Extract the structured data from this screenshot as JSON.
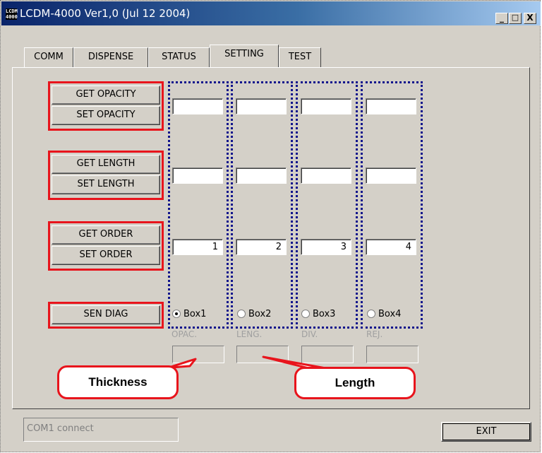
{
  "window": {
    "title": "LCDM-4000 Ver1,0 (Jul 12 2004)",
    "icon_text": "LCDM 4000",
    "minimize": "_",
    "maximize": "□",
    "close": "X"
  },
  "tabs": [
    "COMM",
    "DISPENSE",
    "STATUS",
    "SETTING",
    "TEST"
  ],
  "active_tab": "SETTING",
  "buttons": {
    "get_opacity": "GET OPACITY",
    "set_opacity": "SET OPACITY",
    "get_length": "GET LENGTH",
    "set_length": "SET LENGTH",
    "get_order": "GET ORDER",
    "set_order": "SET ORDER",
    "sen_diag": "SEN DIAG",
    "exit": "EXIT"
  },
  "boxes": [
    {
      "label": "Box1",
      "selected": true,
      "opacity": "",
      "length": "",
      "order": "1",
      "sub_label": "OPAC.",
      "sub_value": ""
    },
    {
      "label": "Box2",
      "selected": false,
      "opacity": "",
      "length": "",
      "order": "2",
      "sub_label": "LENG.",
      "sub_value": ""
    },
    {
      "label": "Box3",
      "selected": false,
      "opacity": "",
      "length": "",
      "order": "3",
      "sub_label": "DIV.",
      "sub_value": ""
    },
    {
      "label": "Box4",
      "selected": false,
      "opacity": "",
      "length": "",
      "order": "4",
      "sub_label": "REJ.",
      "sub_value": ""
    }
  ],
  "callouts": {
    "thickness": "Thickness",
    "length": "Length"
  },
  "status": "COM1 connect",
  "colors": {
    "highlight_red": "#e8141c",
    "box_outline_blue": "#10148c"
  }
}
